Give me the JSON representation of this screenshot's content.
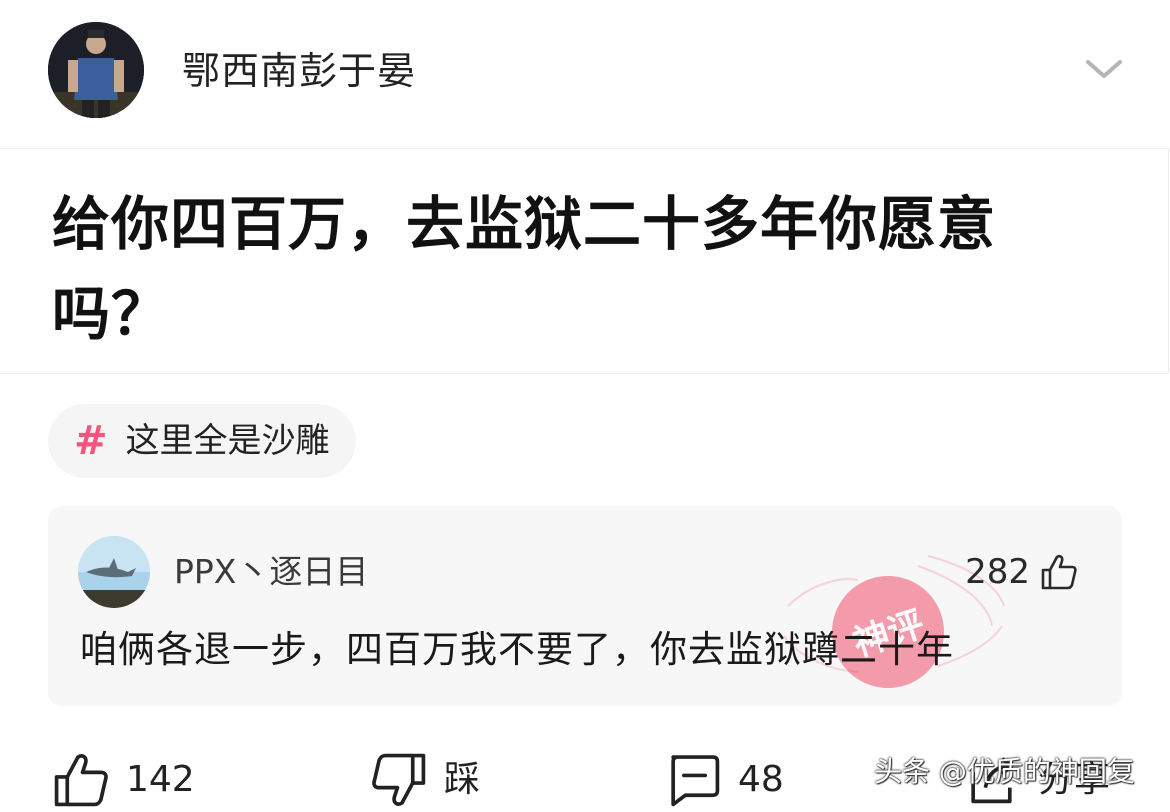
{
  "header": {
    "username": "鄂西南彭于晏",
    "avatar_icon": "user-avatar",
    "menu_icon": "chevron-down-icon"
  },
  "post": {
    "title": "给你四百万，去监狱二十多年你愿意吗？"
  },
  "topic": {
    "hash_symbol": "#",
    "label": "这里全是沙雕"
  },
  "god_comment": {
    "username": "PPX丶逐日目",
    "likes": "282",
    "text": "咱俩各退一步，四百万我不要了，你去监狱蹲二十年",
    "stamp_text": "神评",
    "stamp_color": "#f0506e"
  },
  "actions": {
    "like_count": "142",
    "dislike_label": "踩",
    "comment_count": "48",
    "share_label": "分享"
  },
  "watermark": "头条 @优质的神回复",
  "colors": {
    "accent_pink": "#f5557c",
    "card_bg": "#f7f7f8",
    "text": "#1a1a1a"
  }
}
